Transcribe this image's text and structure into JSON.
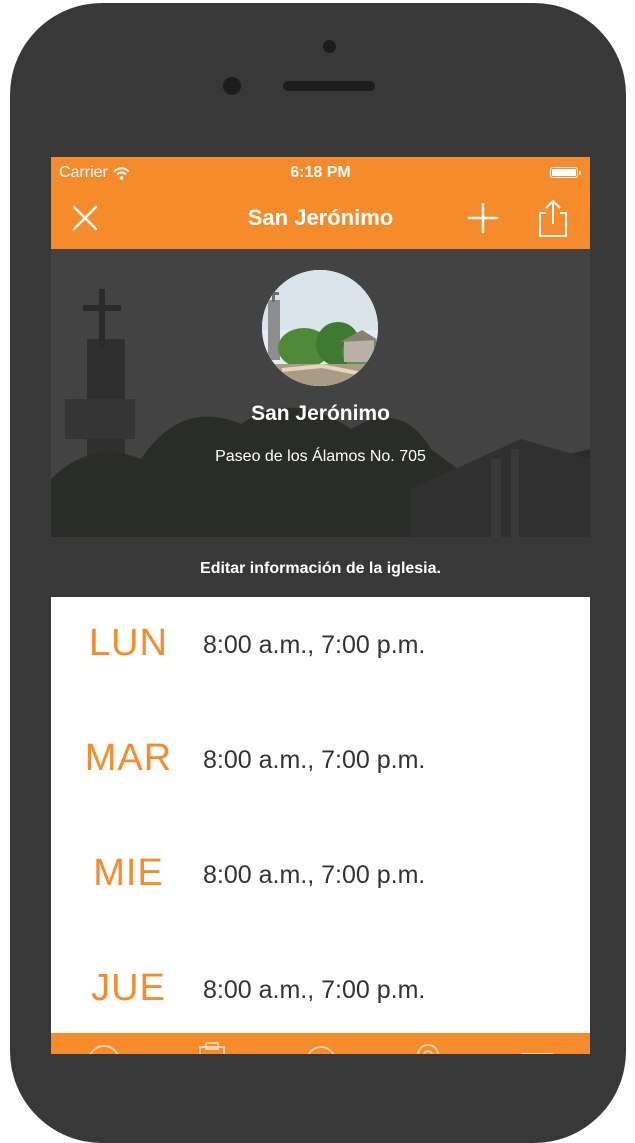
{
  "status_bar": {
    "carrier": "Carrier",
    "time": "6:18 PM"
  },
  "nav": {
    "title": "San Jerónimo",
    "close_icon": "close-icon",
    "add_icon": "plus-icon",
    "share_icon": "share-icon"
  },
  "church": {
    "name": "San Jerónimo",
    "address": "Paseo de los Álamos No. 705",
    "edit_label": "Editar información de la iglesia."
  },
  "schedule": [
    {
      "day": "LUN",
      "times": "8:00 a.m., 7:00 p.m."
    },
    {
      "day": "MAR",
      "times": "8:00 a.m., 7:00 p.m."
    },
    {
      "day": "MIE",
      "times": "8:00 a.m., 7:00 p.m."
    },
    {
      "day": "JUE",
      "times": "8:00 a.m., 7:00 p.m."
    }
  ],
  "tab_icons": [
    "clock-icon",
    "clipboard-icon",
    "location-icon",
    "pin-icon",
    "menu-icon"
  ],
  "colors": {
    "accent": "#f68b2c",
    "device": "#383838",
    "text": "#333333"
  }
}
